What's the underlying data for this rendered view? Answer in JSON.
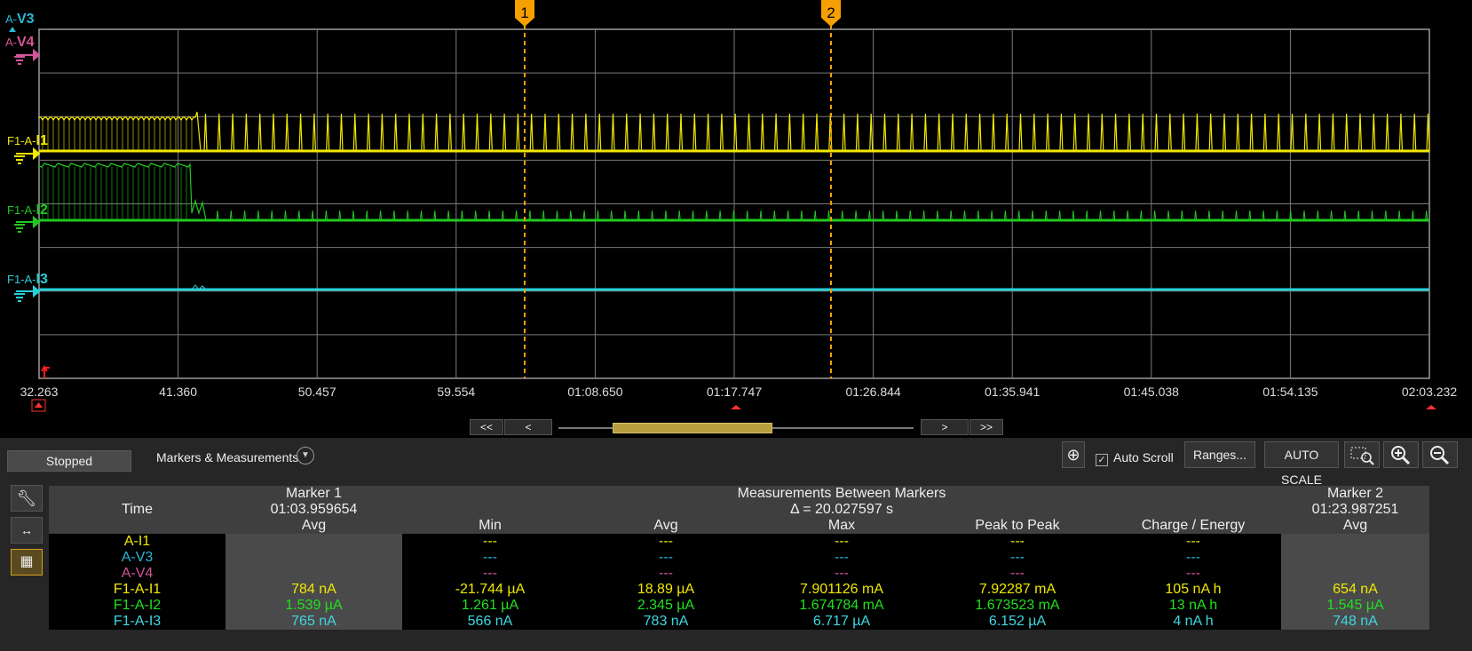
{
  "scope": {
    "channels": [
      {
        "id": "A-V3",
        "prefix": "A-",
        "suffix": "V3",
        "color": "#29b6d6"
      },
      {
        "id": "A-V4",
        "prefix": "A-",
        "suffix": "V4",
        "color": "#d4559a"
      },
      {
        "id": "F1-A-I1",
        "prefix": "F1-A-",
        "suffix": "I1",
        "color": "#f0e800"
      },
      {
        "id": "F1-A-I2",
        "prefix": "F1-A-",
        "suffix": "I2",
        "color": "#21c821"
      },
      {
        "id": "F1-A-I3",
        "prefix": "F1-A-",
        "suffix": "I3",
        "color": "#29cfd9"
      }
    ],
    "time_ticks": [
      "32.263",
      "41.360",
      "50.457",
      "59.554",
      "01:08.650",
      "01:17.747",
      "01:26.844",
      "01:35.941",
      "01:45.038",
      "01:54.135",
      "02:03.232"
    ],
    "marker1_label": "1",
    "marker2_label": "2",
    "marker_color": "#f5a000"
  },
  "nav": {
    "first": "<<",
    "prev": "<",
    "next": ">",
    "last": ">>"
  },
  "panel": {
    "status": "Stopped",
    "markers_measurements": "Markers & Measurements",
    "auto_scroll": "Auto Scroll",
    "ranges_button": "Ranges...",
    "auto_scale_button": "AUTO SCALE",
    "zoom_box_icon": "zoom-box-icon",
    "zoom_in_icon": "zoom-in-icon",
    "zoom_out_icon": "zoom-out-icon"
  },
  "table": {
    "time_label": "Time",
    "marker1": {
      "title": "Marker 1",
      "time": "01:03.959654",
      "col": "Avg"
    },
    "between": {
      "title": "Measurements Between Markers",
      "delta": "Δ = 20.027597 s",
      "cols": [
        "Min",
        "Avg",
        "Max",
        "Peak to Peak",
        "Charge / Energy"
      ]
    },
    "marker2": {
      "title": "Marker 2",
      "time": "01:23.987251",
      "col": "Avg"
    },
    "rows": [
      {
        "name": "A-I1",
        "color": "#f0e800",
        "m1": "",
        "min": "---",
        "avg": "---",
        "max": "---",
        "p2p": "---",
        "charge": "---",
        "m2": ""
      },
      {
        "name": "A-V3",
        "color": "#29b6d6",
        "m1": "",
        "min": "---",
        "avg": "---",
        "max": "---",
        "p2p": "---",
        "charge": "---",
        "m2": ""
      },
      {
        "name": "A-V4",
        "color": "#d4559a",
        "m1": "",
        "min": "---",
        "avg": "---",
        "max": "---",
        "p2p": "---",
        "charge": "---",
        "m2": ""
      },
      {
        "name": "F1-A-I1",
        "color": "#f0e800",
        "m1": "784 nA",
        "min": "-21.744 µA",
        "avg": "18.89 µA",
        "max": "7.901126 mA",
        "p2p": "7.92287 mA",
        "charge": "105 nA h",
        "m2": "654 nA"
      },
      {
        "name": "F1-A-I2",
        "color": "#21e021",
        "m1": "1.539 µA",
        "min": "1.261 µA",
        "avg": "2.345 µA",
        "max": "1.674784 mA",
        "p2p": "1.673523 mA",
        "charge": "13 nA h",
        "m2": "1.545 µA"
      },
      {
        "name": "F1-A-I3",
        "color": "#3fd7e0",
        "m1": "765 nA",
        "min": "566 nA",
        "avg": "783 nA",
        "max": "6.717 µA",
        "p2p": "6.152 µA",
        "charge": "4 nA h",
        "m2": "748 nA"
      }
    ]
  }
}
